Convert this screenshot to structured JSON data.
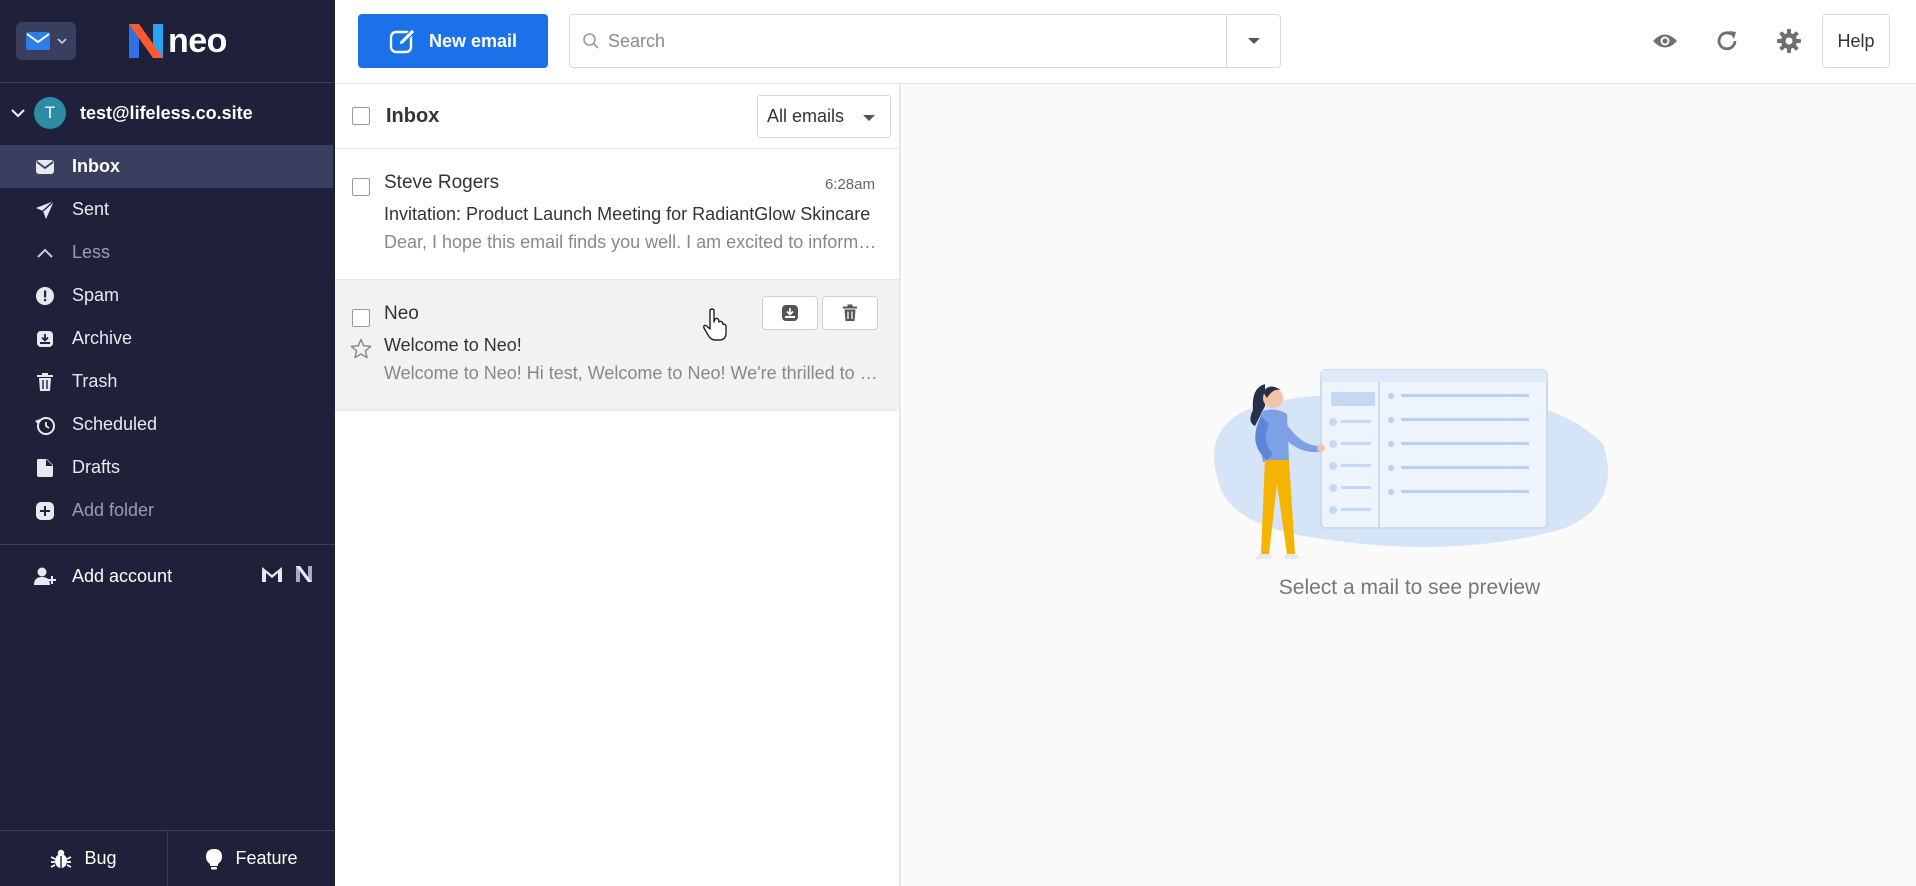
{
  "sidebar": {
    "brand": "neo",
    "account_initial": "T",
    "account_email": "test@lifeless.co.site",
    "folders": [
      {
        "label": "Inbox"
      },
      {
        "label": "Sent"
      },
      {
        "label": "Less"
      },
      {
        "label": "Spam"
      },
      {
        "label": "Archive"
      },
      {
        "label": "Trash"
      },
      {
        "label": "Scheduled"
      },
      {
        "label": "Drafts"
      },
      {
        "label": "Add folder"
      }
    ],
    "add_account": "Add account",
    "bug_label": "Bug",
    "feature_label": "Feature"
  },
  "topbar": {
    "new_email": "New email",
    "search_placeholder": "Search",
    "help": "Help"
  },
  "list": {
    "title": "Inbox",
    "filter": "All emails",
    "items": [
      {
        "sender": "Steve Rogers",
        "time": "6:28am",
        "subject": "Invitation: Product Launch Meeting for RadiantGlow Skincare",
        "preview": "Dear, I hope this email finds you well. I am excited to inform you"
      },
      {
        "sender": "Neo",
        "time": "",
        "subject": "Welcome to Neo!",
        "preview": "Welcome to Neo! Hi test, Welcome to Neo! We're thrilled to have you"
      }
    ]
  },
  "preview_pane": {
    "empty_text": "Select a mail to see preview"
  },
  "colors": {
    "sidebar_bg": "#1e2139",
    "accent": "#1b72e8",
    "avatar": "#2b8ca3"
  }
}
